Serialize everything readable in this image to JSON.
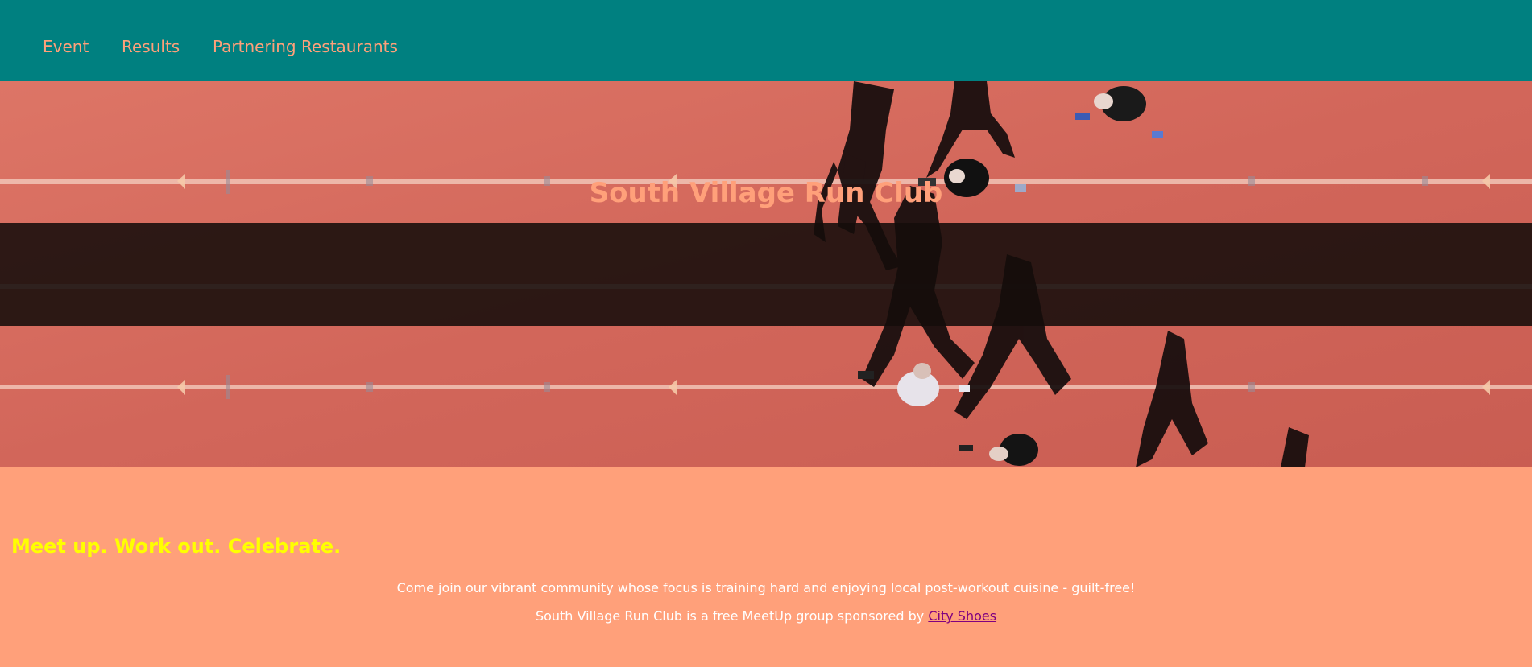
{
  "nav": {
    "items": [
      {
        "label": "Event"
      },
      {
        "label": "Results"
      },
      {
        "label": "Partnering Restaurants"
      }
    ]
  },
  "hero": {
    "title": "South Village Run Club"
  },
  "intro": {
    "tagline": "Meet up. Work out. Celebrate.",
    "description": "Come join our vibrant community whose focus is training hard and enjoying local post-workout cuisine - guilt-free!",
    "sponsor_text": "South Village Run Club is a free MeetUp group sponsored by ",
    "sponsor_link": "City Shoes"
  },
  "colors": {
    "nav_background": "#008080",
    "accent": "#ffa07a",
    "tagline": "#ffff00",
    "link": "#800080",
    "track": "#d4695d"
  },
  "icons": {
    "hero_image": "runners-on-track-photo"
  }
}
